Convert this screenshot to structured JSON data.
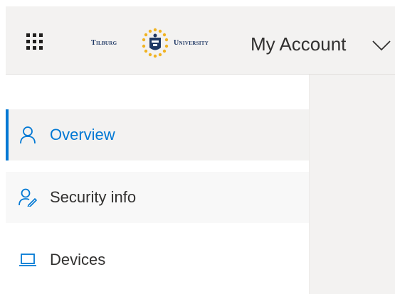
{
  "header": {
    "app_launcher_icon": "waffle-icon",
    "logo": {
      "left_text": "Tilburg",
      "right_text": "University"
    },
    "title": "My Account",
    "dropdown_icon": "chevron-down-icon"
  },
  "nav": {
    "items": [
      {
        "label": "Overview",
        "icon": "person-icon",
        "selected": true
      },
      {
        "label": "Security info",
        "icon": "person-key-icon",
        "selected": false
      },
      {
        "label": "Devices",
        "icon": "laptop-icon",
        "selected": false
      }
    ]
  },
  "colors": {
    "accent": "#0078d4",
    "header_bg": "#f3f2f1",
    "text": "#323130",
    "selected_bg": "#f3f2f1"
  }
}
